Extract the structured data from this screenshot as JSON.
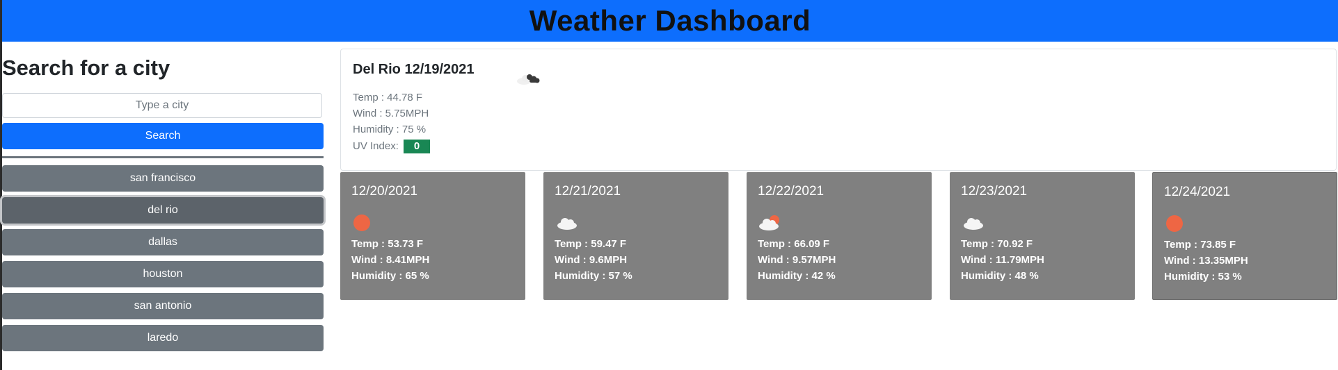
{
  "header": {
    "title": "Weather Dashboard"
  },
  "sidebar": {
    "heading": "Search for a city",
    "input_placeholder": "Type a city",
    "input_value": "",
    "search_label": "Search",
    "history": [
      "san francisco",
      "del rio",
      "dallas",
      "houston",
      "san antonio",
      "laredo"
    ],
    "active_index": 1
  },
  "current": {
    "title": "Del Rio 12/19/2021",
    "icon": "broken-clouds-icon",
    "temp": "Temp : 44.78 F",
    "wind": "Wind : 5.75MPH",
    "humidity": "Humidity : 75 %",
    "uv_label": "UV Index:",
    "uv_value": "0",
    "uv_color": "#198754"
  },
  "forecast": [
    {
      "date": "12/20/2021",
      "icon": "sun-icon",
      "temp": "Temp : 53.73 F",
      "wind": "Wind : 8.41MPH",
      "humidity": "Humidity : 65 %"
    },
    {
      "date": "12/21/2021",
      "icon": "cloud-icon",
      "temp": "Temp : 59.47 F",
      "wind": "Wind : 9.6MPH",
      "humidity": "Humidity : 57 %"
    },
    {
      "date": "12/22/2021",
      "icon": "partly-cloudy-icon",
      "temp": "Temp : 66.09 F",
      "wind": "Wind : 9.57MPH",
      "humidity": "Humidity : 42 %"
    },
    {
      "date": "12/23/2021",
      "icon": "cloud-icon",
      "temp": "Temp : 70.92 F",
      "wind": "Wind : 11.79MPH",
      "humidity": "Humidity : 48 %"
    },
    {
      "date": "12/24/2021",
      "icon": "sun-icon",
      "temp": "Temp : 73.85 F",
      "wind": "Wind : 13.35MPH",
      "humidity": "Humidity : 53 %"
    }
  ],
  "colors": {
    "header_bg": "#0d6efd",
    "search_button": "#0d6efd",
    "history_button": "#6c757d",
    "forecast_card": "#808080",
    "sun": "#ee6644"
  }
}
